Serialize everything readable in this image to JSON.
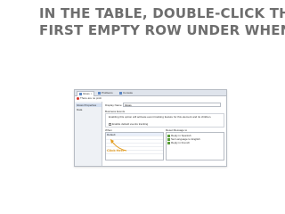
{
  "title": {
    "lines": [
      "In the table, double-click the",
      "first empty row under When:"
    ]
  },
  "screenshot": {
    "tabs": [
      "Gloss",
      "Problems",
      "Console"
    ],
    "error_text": "There are no prob",
    "side_items": [
      "Gloss Properties",
      "Data"
    ],
    "display_name_label": "Display Name",
    "display_name_value": "Gloss",
    "business_events_label": "Business Events",
    "business_events_description": "Enabling this option will activate event tracking feature for this element and its children.",
    "enable_label": "Enable default events tracking",
    "when_label": "When",
    "when_rows": [
      "Default",
      "",
      "",
      "",
      "",
      ""
    ],
    "reset_label": "Reset Message to",
    "reset_items": [
      "Reply in Spanish",
      "Set Language to English",
      "Reply in French"
    ],
    "click_hint": "Click Here",
    "colors": {
      "accent": "#e39b1b",
      "title": "#6e6e6e"
    }
  }
}
